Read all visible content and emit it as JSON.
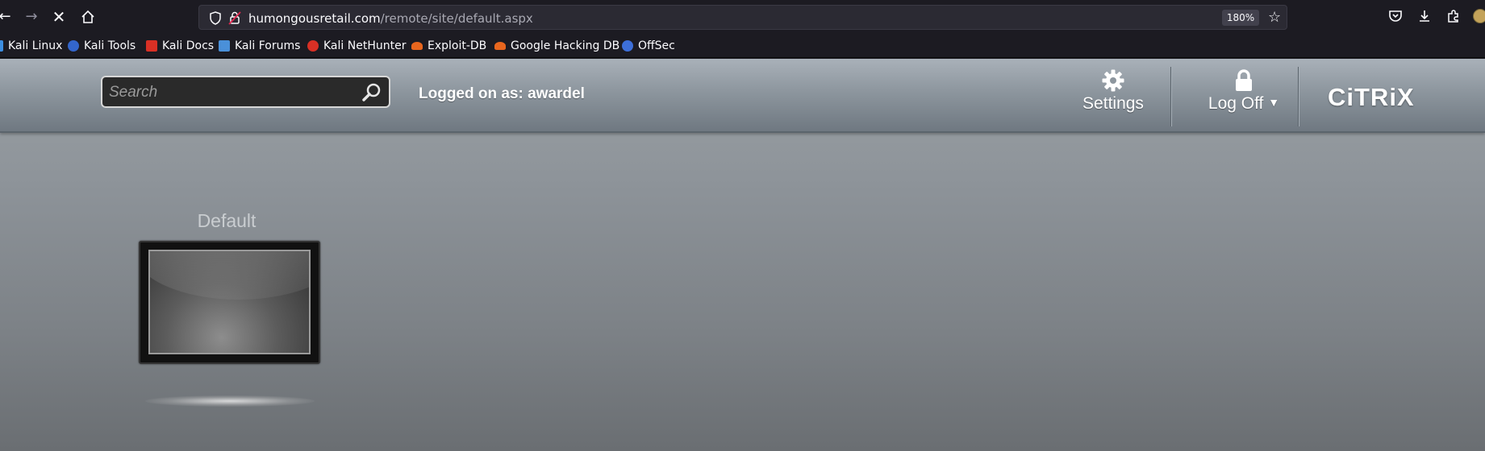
{
  "browser": {
    "url_host": "humongousretail.com",
    "url_path": "/remote/site/default.aspx",
    "zoom": "180%",
    "bookmarks": [
      {
        "label": "Kali Linux",
        "icon": "kali-dragon-icon",
        "color": "#3d8ee0"
      },
      {
        "label": "Kali Tools",
        "icon": "kali-tools-icon",
        "color": "#3366cc"
      },
      {
        "label": "Kali Docs",
        "icon": "kali-docs-icon",
        "color": "#d93025"
      },
      {
        "label": "Kali Forums",
        "icon": "kali-forums-icon",
        "color": "#4a90d9"
      },
      {
        "label": "Kali NetHunter",
        "icon": "kali-nethunter-icon",
        "color": "#d93025"
      },
      {
        "label": "Exploit-DB",
        "icon": "exploit-db-icon",
        "color": "#e8661e"
      },
      {
        "label": "Google Hacking DB",
        "icon": "ghdb-icon",
        "color": "#e8661e"
      },
      {
        "label": "OffSec",
        "icon": "offsec-icon",
        "color": "#3d6fd9"
      }
    ]
  },
  "header": {
    "search_placeholder": "Search",
    "logged_on": "Logged on as: awardel",
    "settings_label": "Settings",
    "logoff_label": "Log Off",
    "logo_text": "CiTRiX"
  },
  "apps": [
    {
      "name": "Default"
    }
  ],
  "colors": {
    "header_top": "#a9b1b9",
    "header_bottom": "#6f7881",
    "page_bg": "#8e949a"
  }
}
